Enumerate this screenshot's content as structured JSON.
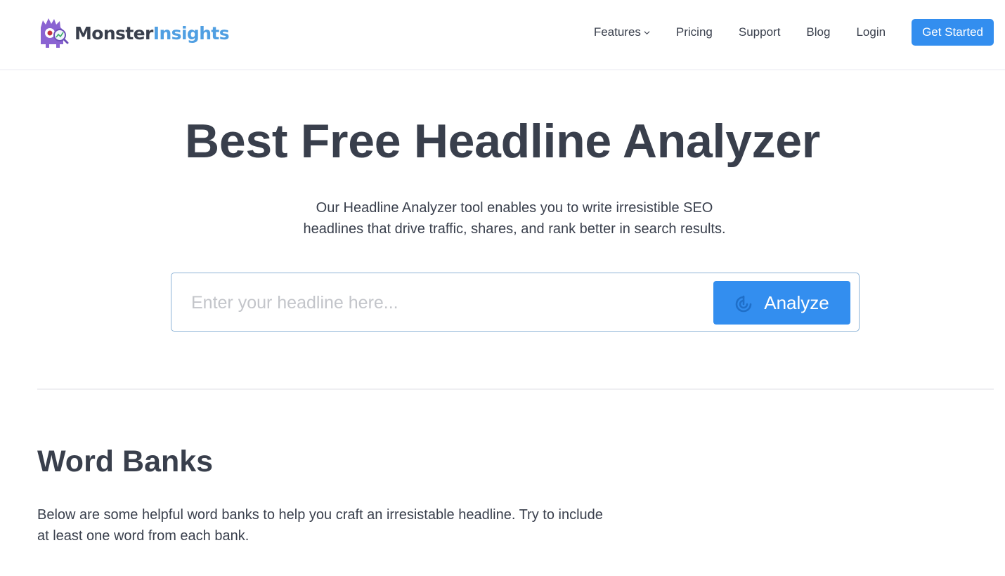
{
  "header": {
    "logo": {
      "icon": "monster-mascot-icon",
      "text_part1": "Monster",
      "text_part2": "Insights"
    },
    "nav": [
      {
        "label": "Features",
        "has_dropdown": true,
        "icon": "chevron-down-icon"
      },
      {
        "label": "Pricing"
      },
      {
        "label": "Support"
      },
      {
        "label": "Blog"
      },
      {
        "label": "Login"
      }
    ],
    "cta_label": "Get Started"
  },
  "hero": {
    "title": "Best Free Headline Analyzer",
    "subtitle_line1": "Our Headline Analyzer tool enables you to write irresistible SEO",
    "subtitle_line2": "headlines that drive traffic, shares, and rank better in search results.",
    "input": {
      "value": "",
      "placeholder": "Enter your headline here..."
    },
    "analyze_button": {
      "label": "Analyze",
      "icon": "radar-icon"
    }
  },
  "word_banks": {
    "title": "Word Banks",
    "description": "Below are some helpful word banks to help you craft an irresistable headline. Try to include at least one word from each bank."
  },
  "colors": {
    "brand_blue": "#338eef",
    "logo_blue": "#509fe2",
    "text_dark": "#393f4c",
    "input_border": "#8eb4d6",
    "mascot_purple": "#8a63d2"
  }
}
